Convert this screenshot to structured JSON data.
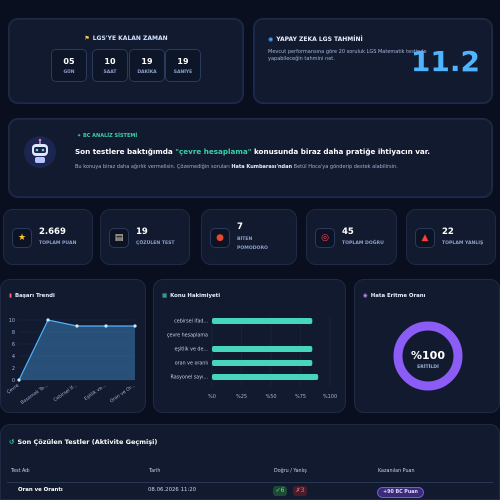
{
  "countdown": {
    "title": "LGS'YE KALAN ZAMAN",
    "boxes": [
      {
        "value": "05",
        "unit": "GÜN"
      },
      {
        "value": "10",
        "unit": "SAAT"
      },
      {
        "value": "19",
        "unit": "DAKİKA"
      },
      {
        "value": "19",
        "unit": "SANİYE"
      }
    ]
  },
  "prediction": {
    "title": "YAPAY ZEKA LGS TAHMİNİ",
    "desc": "Mevcut performansına göre 20 soruluk LGS Matematik testinde yapabileceğin tahmini net.",
    "score": "11.2"
  },
  "ai": {
    "system": "BC ANALİZ SİSTEMİ",
    "head_pre": "Son testlere baktığımda ",
    "head_hl": "\"çevre hesaplama\"",
    "head_post": " konusunda biraz daha pratiğe ihtiyacın var.",
    "sub_pre": "Bu konuya biraz daha ağırlık vermelisin. Çözemediğin soruları ",
    "sub_bold": "Hata Kumbarası'ndan",
    "sub_post": " Betül Hoca'ya gönderip destek alabilirsin."
  },
  "stats": [
    {
      "value": "2.669",
      "name": "TOPLAM PUAN",
      "icon": "star-icon",
      "glyph": "★",
      "color": "#ffc233"
    },
    {
      "value": "19",
      "name": "ÇÖZÜLEN TEST",
      "icon": "document-icon",
      "glyph": "▤",
      "color": "#f3e6c8"
    },
    {
      "value": "7",
      "name": "BİTEN POMODORO",
      "name1": "BİTEN",
      "name2": "POMODORO",
      "icon": "tomato-icon",
      "glyph": "●",
      "color": "#e8462f"
    },
    {
      "value": "45",
      "name": "TOPLAM DOĞRU",
      "icon": "target-icon",
      "glyph": "◎",
      "color": "#ff4a5a"
    },
    {
      "value": "22",
      "name": "TOPLAM YANLIŞ",
      "icon": "alert-icon",
      "glyph": "▲",
      "color": "#ff3b3b"
    }
  ],
  "panels": {
    "trend_title": "Başarı Trendi",
    "mastery_title": "Konu Hakimiyeti",
    "error_title": "Hata Eritme Oranı"
  },
  "chart_data": [
    {
      "type": "area",
      "title": "Başarı Trendi",
      "categories": [
        "Çevre",
        "Basamak Te...",
        "Cebirsel İf...",
        "Eşitlik ve...",
        "Oran ve Or..."
      ],
      "values": [
        0,
        10,
        9,
        9,
        9
      ],
      "yticks": [
        0,
        2,
        4,
        6,
        8,
        10
      ],
      "ylim": [
        0,
        10
      ],
      "color": "#4fb4ff"
    },
    {
      "type": "bar",
      "title": "Konu Hakimiyeti",
      "categories": [
        "cebirsel ifad...",
        "çevre hesaplama",
        "eşitlik ve de...",
        "oran ve oranlı",
        "Rasyonel sayı..."
      ],
      "values": [
        85,
        0,
        85,
        85,
        90
      ],
      "xticks": [
        "%0",
        "%25",
        "%50",
        "%75",
        "%100"
      ],
      "xlim": [
        0,
        100
      ],
      "color": "#46d6c0"
    },
    {
      "type": "pie",
      "title": "Hata Eritme Oranı",
      "value": 100,
      "label": "%100",
      "sublabel": "ERİTİLDİ",
      "color": "#8b5cf6"
    }
  ],
  "history": {
    "title": "Son Çözülen Testler (Aktivite Geçmişi)",
    "columns": [
      "Test Adı",
      "Tarih",
      "Doğru / Yanlış",
      "Kazanılan Puan"
    ],
    "rows": [
      {
        "name": "Oran ve Orantı",
        "date": "08.06.2026 11:20",
        "correct": "✓6",
        "wrong": "✗3",
        "points": "+90 BC Puan"
      }
    ]
  }
}
